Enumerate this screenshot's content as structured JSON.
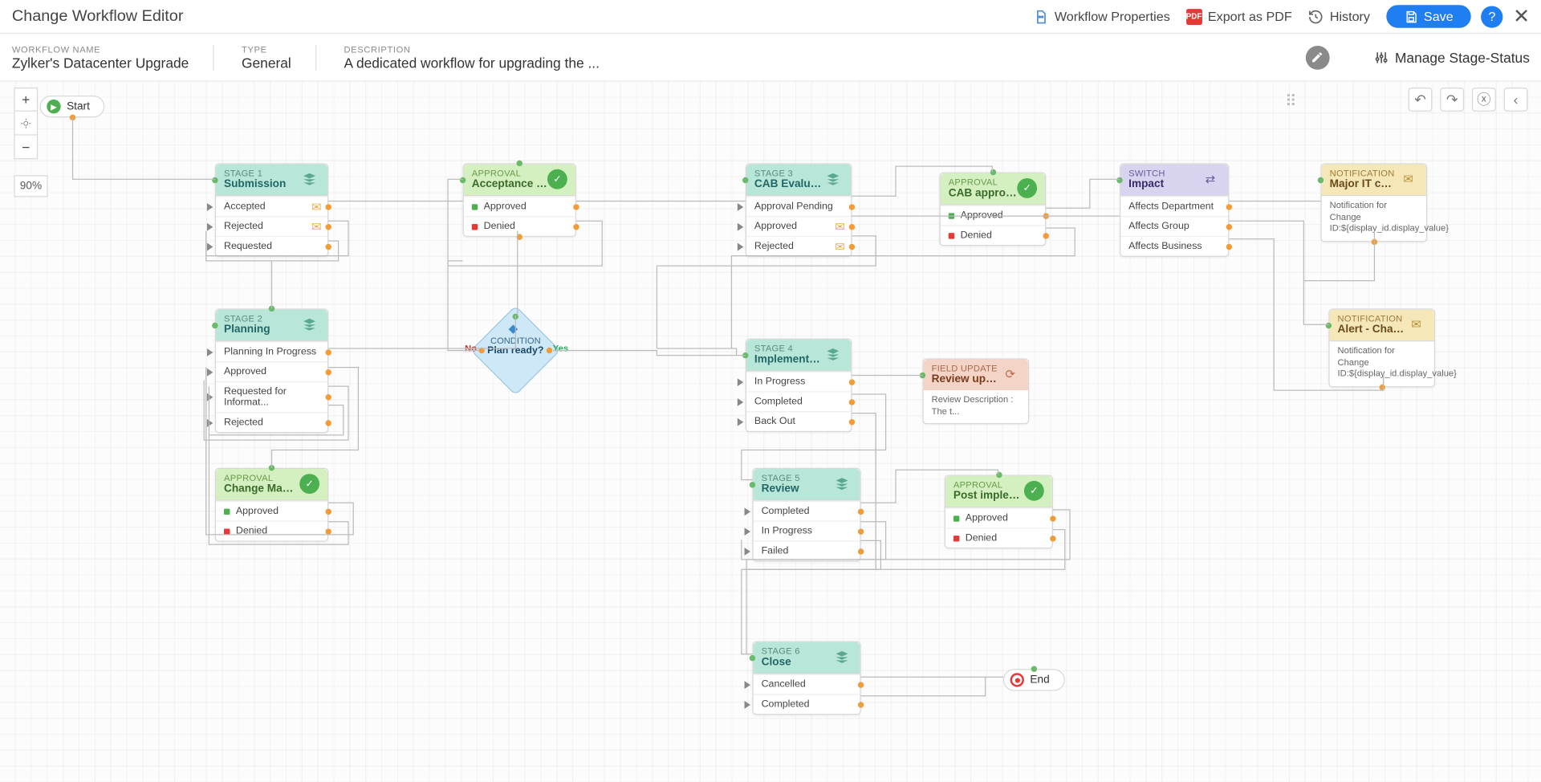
{
  "topbar": {
    "title": "Change Workflow Editor",
    "workflow_properties": "Workflow Properties",
    "export_pdf": "Export as PDF",
    "history": "History",
    "save": "Save"
  },
  "infobar": {
    "name_label": "WORKFLOW NAME",
    "name_value": "Zylker's Datacenter Upgrade",
    "type_label": "TYPE",
    "type_value": "General",
    "desc_label": "DESCRIPTION",
    "desc_value": "A dedicated workflow for upgrading the ...",
    "manage": "Manage Stage-Status"
  },
  "zoom": {
    "level": "90%"
  },
  "flow": {
    "start": "Start",
    "end": "End",
    "condition": {
      "label": "CONDITION",
      "title": "Plan ready?",
      "no": "No",
      "yes": "Yes"
    }
  },
  "nodes": {
    "stage1": {
      "label": "STAGE 1",
      "title": "Submission",
      "rows": [
        "Accepted",
        "Rejected",
        "Requested"
      ]
    },
    "stage2": {
      "label": "STAGE 2",
      "title": "Planning",
      "rows": [
        "Planning In Progress",
        "Approved",
        "Requested for Informat...",
        "Rejected"
      ]
    },
    "stage3": {
      "label": "STAGE 3",
      "title": "CAB Evaluation",
      "rows": [
        "Approval Pending",
        "Approved",
        "Rejected"
      ]
    },
    "stage4": {
      "label": "STAGE 4",
      "title": "Implementation",
      "rows": [
        "In Progress",
        "Completed",
        "Back Out"
      ]
    },
    "stage5": {
      "label": "STAGE 5",
      "title": "Review",
      "rows": [
        "Completed",
        "In Progress",
        "Failed"
      ]
    },
    "stage6": {
      "label": "STAGE 6",
      "title": "Close",
      "rows": [
        "Cancelled",
        "Completed"
      ]
    },
    "approval_accept": {
      "label": "APPROVAL",
      "title": "Acceptance of the...",
      "rows": [
        [
          "g",
          "Approved"
        ],
        [
          "r",
          "Denied"
        ]
      ]
    },
    "approval_cab": {
      "label": "APPROVAL",
      "title": "CAB approval",
      "rows": [
        [
          "g",
          "Approved"
        ],
        [
          "r",
          "Denied"
        ]
      ]
    },
    "approval_cm": {
      "label": "APPROVAL",
      "title": "Change Manager's...",
      "rows": [
        [
          "g",
          "Approved"
        ],
        [
          "r",
          "Denied"
        ]
      ]
    },
    "approval_post": {
      "label": "APPROVAL",
      "title": "Post implementat...",
      "rows": [
        [
          "g",
          "Approved"
        ],
        [
          "r",
          "Denied"
        ]
      ]
    },
    "switch_impact": {
      "label": "SWITCH",
      "title": "Impact",
      "rows": [
        "Affects Department",
        "Affects Group",
        "Affects Business"
      ]
    },
    "fupdate": {
      "label": "FIELD UPDATE",
      "title": "Review updates",
      "body": "Review Description : The t..."
    },
    "notif_major": {
      "label": "NOTIFICATION",
      "title": "Major IT change",
      "body": "Notification for Change ID:${display_id.display_value}"
    },
    "notif_alert": {
      "label": "NOTIFICATION",
      "title": "Alert - Change in ...",
      "body": "Notification for Change ID:${display_id.display_value}"
    }
  }
}
